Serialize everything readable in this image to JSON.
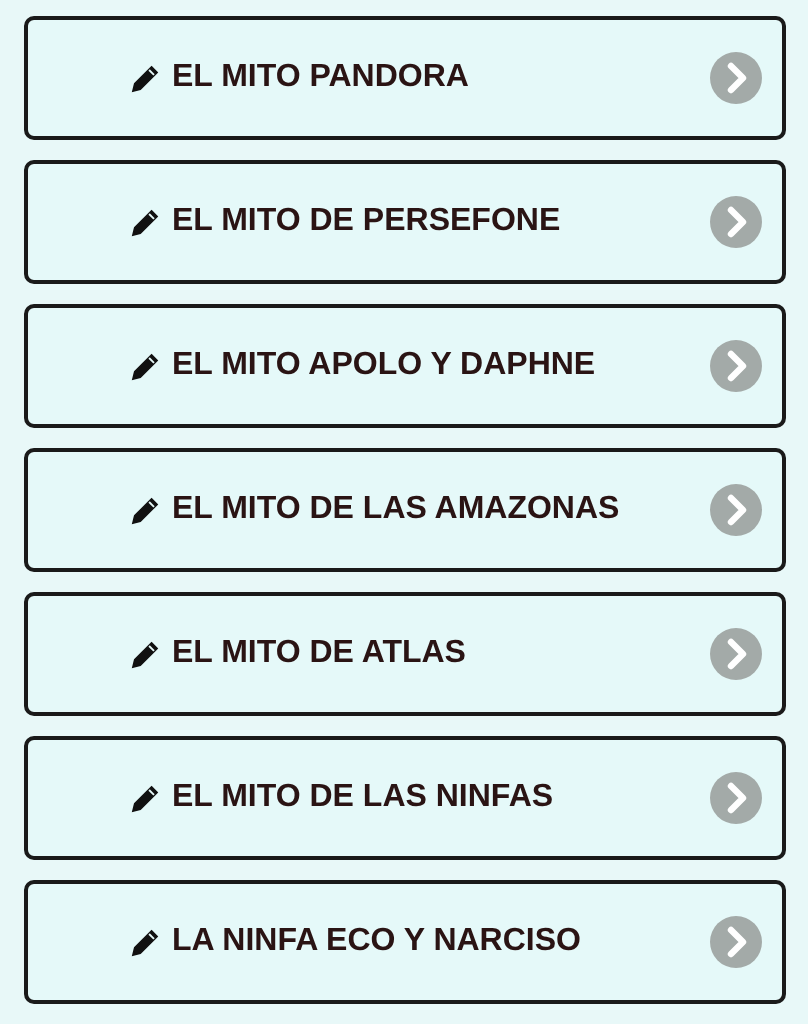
{
  "items": [
    {
      "label": "EL MITO PANDORA"
    },
    {
      "label": "EL MITO DE PERSEFONE"
    },
    {
      "label": "EL MITO APOLO Y DAPHNE"
    },
    {
      "label": "EL MITO DE LAS AMAZONAS"
    },
    {
      "label": "EL MITO DE ATLAS"
    },
    {
      "label": "EL MITO DE LAS NINFAS"
    },
    {
      "label": "LA NINFA ECO Y NARCISO"
    }
  ]
}
